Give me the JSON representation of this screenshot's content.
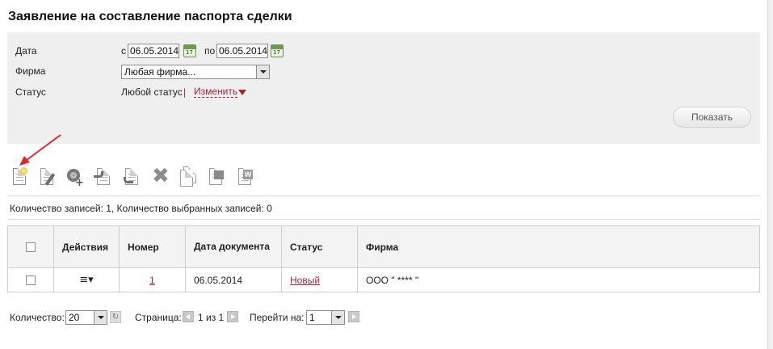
{
  "page": {
    "title": "Заявление на составление паспорта сделки"
  },
  "filter": {
    "date_label": "Дата",
    "date_from_prefix": "с",
    "date_from": "06.05.2014",
    "date_to_prefix": "по",
    "date_to": "06.05.2014",
    "calendar_day": "17",
    "firm_label": "Фирма",
    "firm_value": "Любая фирма...",
    "status_label": "Статус",
    "status_value": "Любой статус",
    "status_separator": "|",
    "change_link": "Изменить",
    "show_button": "Показать"
  },
  "toolbar": {
    "icons": [
      "new-document-icon",
      "edit-document-icon",
      "add-signature-icon",
      "send-document-icon",
      "return-document-icon",
      "delete-icon",
      "copy-document-icon",
      "print-icon",
      "export-word-icon"
    ],
    "word_badge": "W"
  },
  "records_info": "Количество записей: 1, Количество выбранных записей: 0",
  "table": {
    "headers": {
      "actions": "Действия",
      "number": "Номер",
      "date": "Дата документа",
      "status": "Статус",
      "firm": "Фирма"
    },
    "rows": [
      {
        "actions_icon": "≡▾",
        "number": "1",
        "date": "06.05.2014",
        "status": "Новый",
        "firm": "ООО \" **** \""
      }
    ]
  },
  "pager": {
    "count_label": "Количество:",
    "count_value": "20",
    "page_label": "Страница:",
    "page_info": "1 из 1",
    "goto_label": "Перейти на:",
    "goto_value": "1",
    "refresh_glyph": "↻"
  },
  "colors": {
    "accent": "#a8273a",
    "arrow": "#e0262a",
    "filter_bg": "#efefef"
  }
}
